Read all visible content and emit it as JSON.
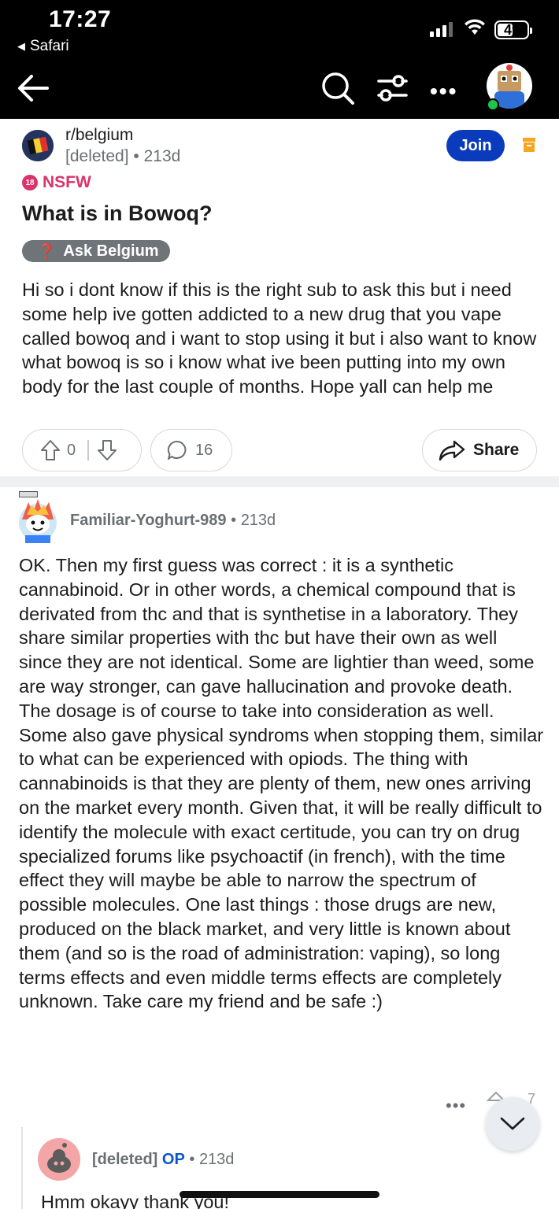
{
  "status_bar": {
    "time": "17:27",
    "back_app": "Safari",
    "battery": "49"
  },
  "nav": {
    "icons": [
      "back-arrow-icon",
      "search-icon",
      "filter-icon",
      "more-icon",
      "user-avatar"
    ]
  },
  "post": {
    "subreddit": "r/belgium",
    "author": "[deleted]",
    "age": "213d",
    "join_label": "Join",
    "nsfw_badge": "18",
    "nsfw_label": "NSFW",
    "title": "What is in Bowoq?",
    "flair_icon": "❓",
    "flair": "Ask Belgium",
    "body": "Hi so i dont know if this is the right sub to ask this but i need some help ive gotten addicted to a new drug that you vape called bowoq and i want to stop using it but i also want to know what bowoq is so i know what ive been putting into my own body for the last couple of months. Hope yall can help me",
    "score": "0",
    "comments": "16",
    "share_label": "Share"
  },
  "comment": {
    "author": "Familiar-Yoghurt-989",
    "age": "213d",
    "body": "OK. Then my first guess was correct : it is a synthetic cannabinoid. Or in other words, a chemical compound that is derivated from thc and that is synthetise in a laboratory. They share similar properties with thc but have their own as well since they are not identical. Some are lightier than weed, some are way stronger, can gave hallucination and provoke death. The dosage is of course to take into consideration as well. Some also gave physical syndroms when stopping them, similar to what can be experienced with opiods. The thing with cannabinoids is that they are plenty of them, new ones arriving on the market every month. Given that, it will be really difficult to identify the molecule with exact certitude, you can try on drug specialized forums like psychoactif (in french), with the time effect they will maybe be able to narrow the spectrum of possible molecules. One last things : those drugs are new, produced on the black market, and very little is known about them (and so is the road of administration: vaping), so long terms effects and even middle terms effects are completely unknown. Take care my friend and be safe :)",
    "more": "•••",
    "vote_peek": "7"
  },
  "reply": {
    "author": "[deleted]",
    "op_label": "OP",
    "age": "213d",
    "body": "Hmm okayy thank you!"
  },
  "colors": {
    "join": "#0a3bbd",
    "nsfw": "#d9356b",
    "op": "#0a56c9",
    "archive": "#f5a623"
  }
}
